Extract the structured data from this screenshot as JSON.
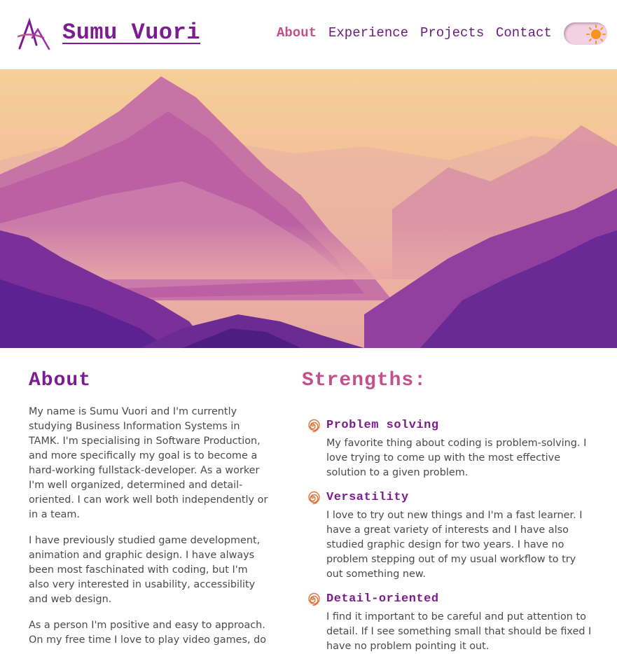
{
  "header": {
    "brand": "Sumu Vuori",
    "nav": [
      {
        "label": "About",
        "active": true
      },
      {
        "label": "Experience",
        "active": false
      },
      {
        "label": "Projects",
        "active": false
      },
      {
        "label": "Contact",
        "active": false
      }
    ],
    "theme_toggle": {
      "icon": "sun-icon",
      "state": "light"
    }
  },
  "about": {
    "title": "About",
    "paragraphs": [
      "My name is Sumu Vuori and I'm currently studying Business Information Systems in TAMK. I'm specialising in Software Production, and more specifically my goal is to become a hard-working fullstack-developer. As a worker I'm well organized, determined and detail-oriented. I can work well both independently or in a team.",
      "I have previously studied game development, animation and graphic design. I have always been most faschinated with coding, but I'm also very interested in usability, accessibility and web design.",
      "As a person I'm positive and easy to approach. On my free time I love to play video games, do"
    ]
  },
  "strengths": {
    "title": "Strengths:",
    "items": [
      {
        "title": "Problem solving",
        "text": "My favorite thing about coding is problem-solving. I love trying to come up with the most effective solution to a given problem."
      },
      {
        "title": "Versatility",
        "text": "I love to try out new things and I'm a fast learner. I have a great variety of interests and I have also studied graphic design for two years. I have no problem stepping out of my usual workflow to try out something new."
      },
      {
        "title": "Detail-oriented",
        "text": "I find it important to be careful and put attention to detail. If I see something small that should be fixed I have no problem pointing it out."
      }
    ]
  },
  "colors": {
    "brand_purple": "#7c1d8f",
    "accent_pink": "#c2508a",
    "spiral_orange": "#e8733a",
    "sun_orange": "#f7931e"
  }
}
